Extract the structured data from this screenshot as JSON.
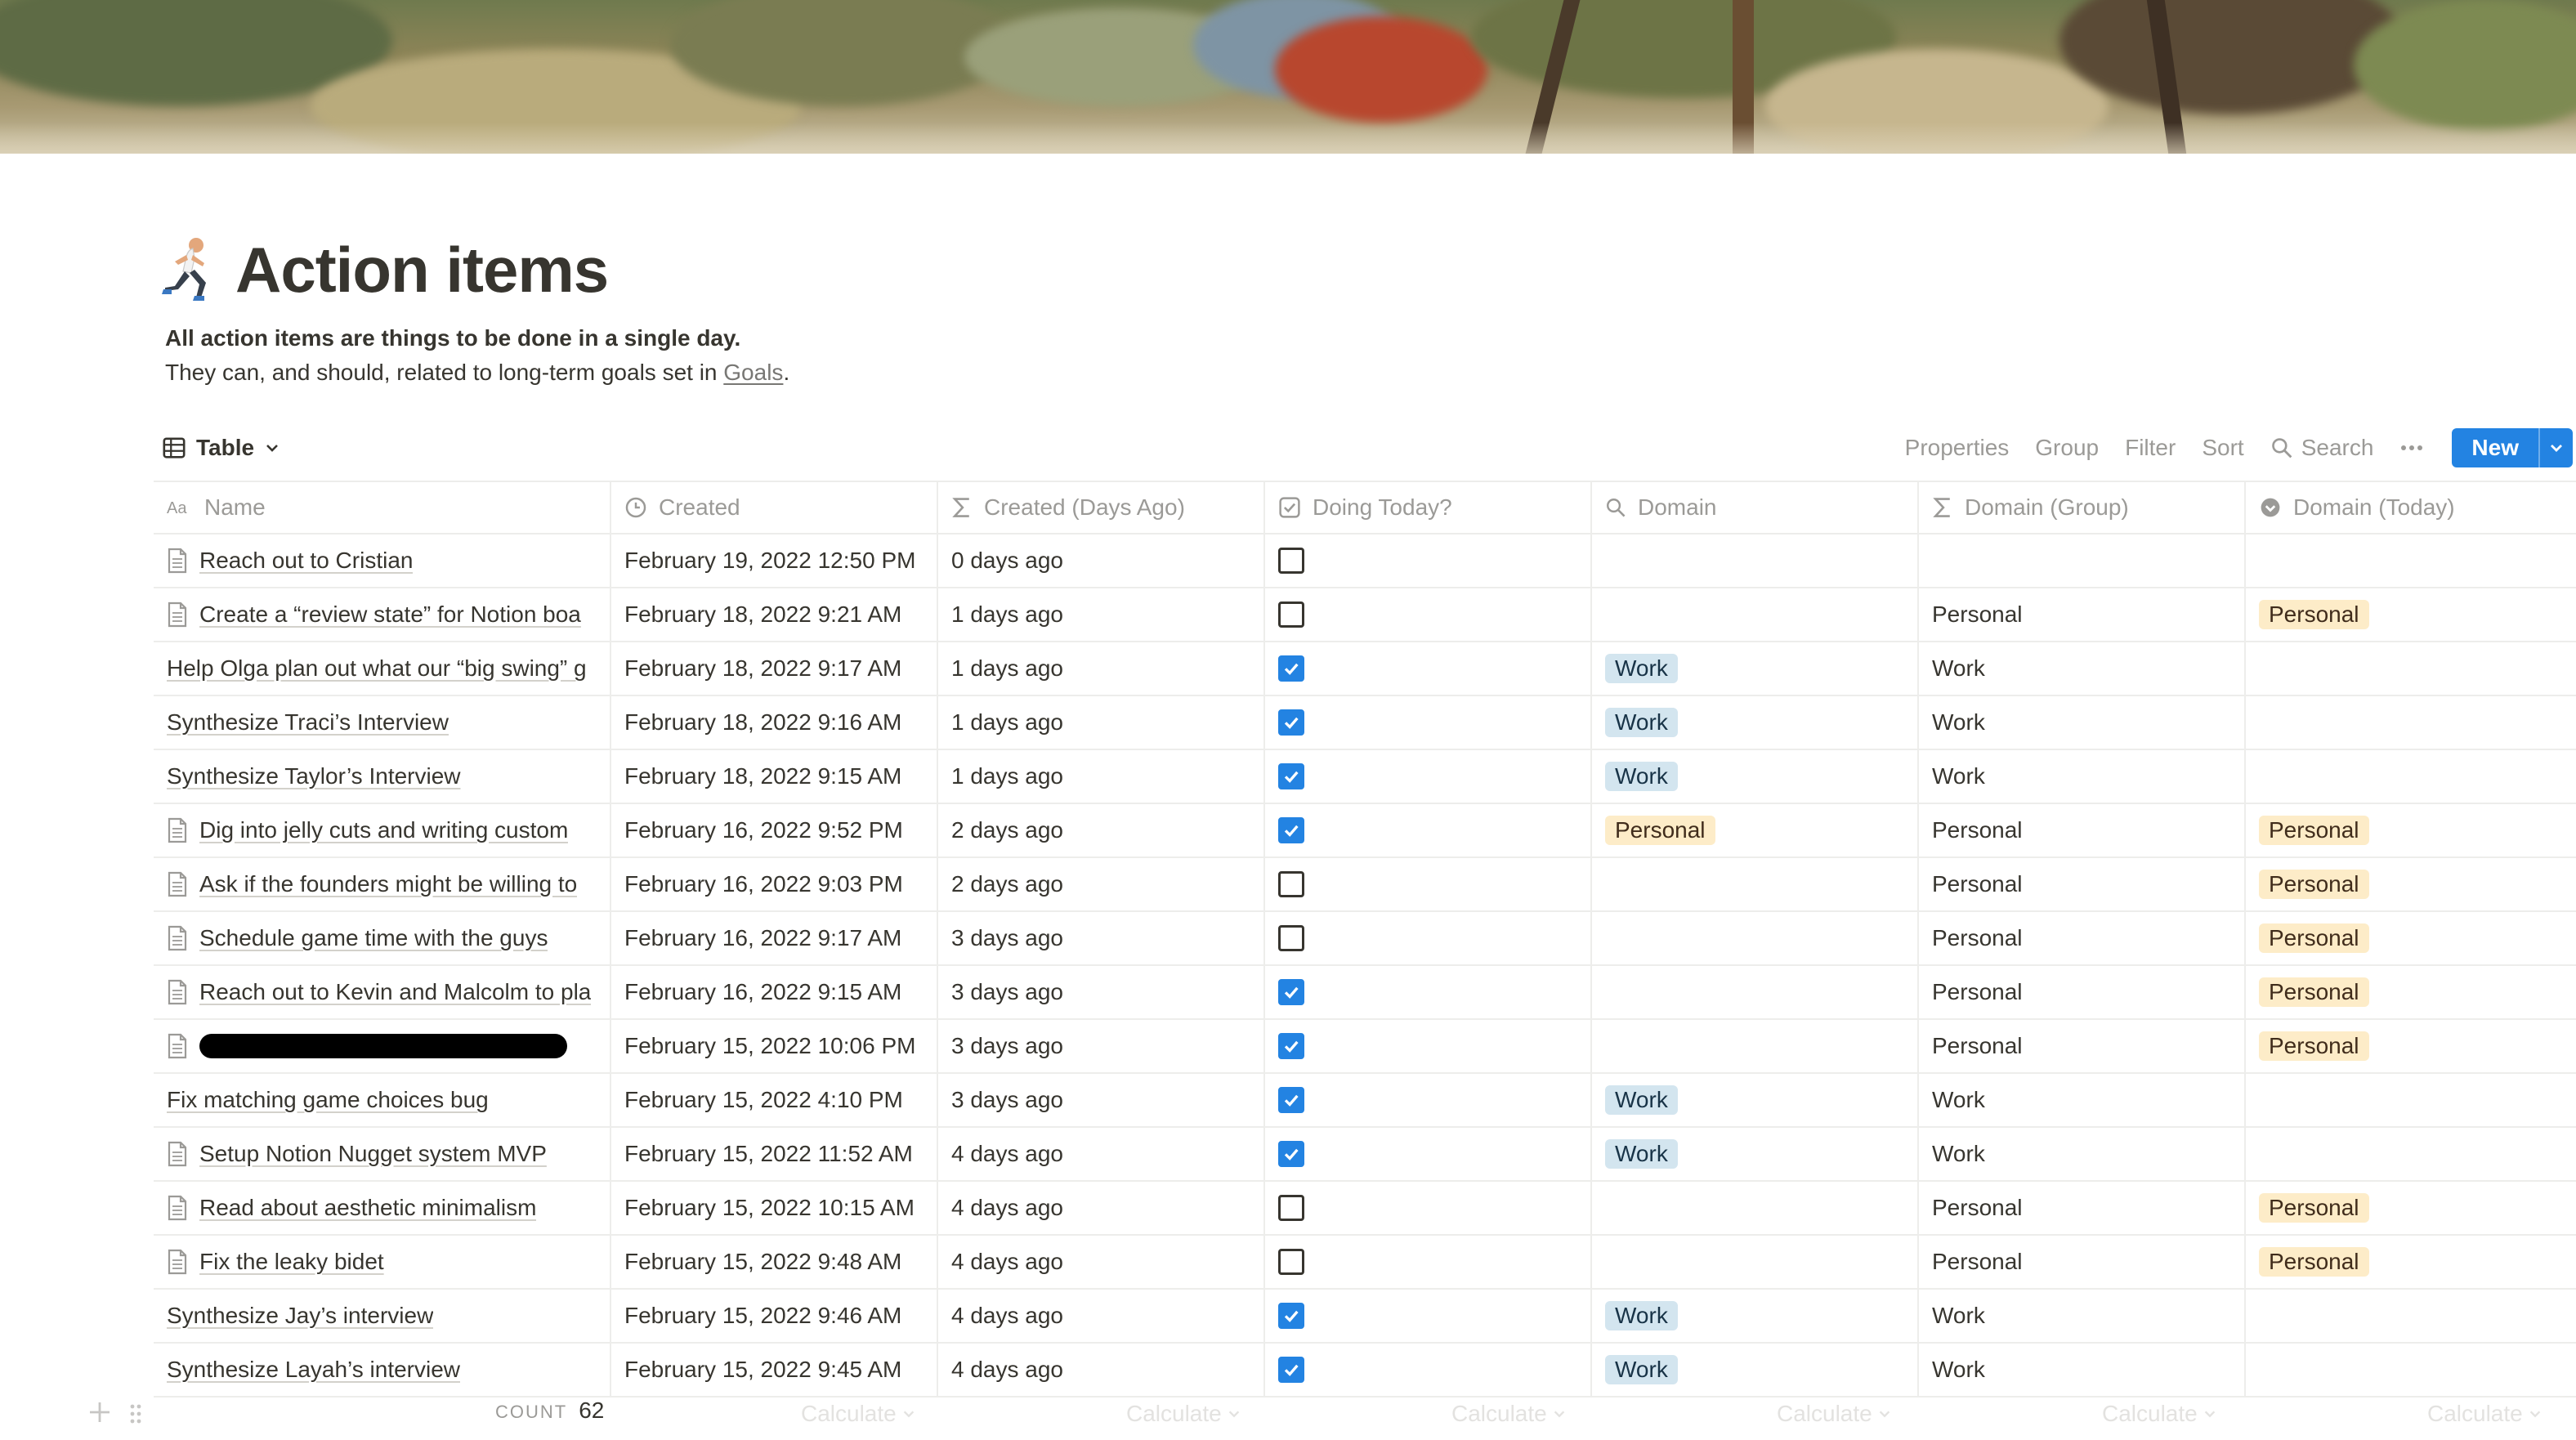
{
  "page": {
    "emoji": "runner-emoji",
    "title": "Action items",
    "description_line1": "All action items are things to be done in a single day.",
    "description_line2_prefix": "They can, and should, related to long-term goals set in ",
    "description_link": "Goals",
    "description_line2_suffix": "."
  },
  "view": {
    "tab_label": "Table",
    "properties": "Properties",
    "group": "Group",
    "filter": "Filter",
    "sort": "Sort",
    "search": "Search",
    "new_label": "New"
  },
  "columns": [
    {
      "label": "Name",
      "icon": "text-aa-icon"
    },
    {
      "label": "Created",
      "icon": "clock-icon"
    },
    {
      "label": "Created (Days Ago)",
      "icon": "sigma-icon"
    },
    {
      "label": "Doing Today?",
      "icon": "checkbox-icon"
    },
    {
      "label": "Domain",
      "icon": "search-relation-icon"
    },
    {
      "label": "Domain (Group)",
      "icon": "sigma-icon"
    },
    {
      "label": "Domain (Today)",
      "icon": "rollup-icon"
    }
  ],
  "rows": [
    {
      "name": "Reach out to Cristian",
      "doc": true,
      "created": "February 19, 2022 12:50 PM",
      "days": "0 days ago",
      "today": false,
      "domain": "",
      "group": "",
      "dtoday": ""
    },
    {
      "name": "Create a “review state” for Notion boa",
      "doc": true,
      "created": "February 18, 2022 9:21 AM",
      "days": "1 days ago",
      "today": false,
      "domain": "",
      "group": "Personal",
      "dtoday": "Personal"
    },
    {
      "name": "Help Olga plan out what our “big swing” g",
      "doc": false,
      "created": "February 18, 2022 9:17 AM",
      "days": "1 days ago",
      "today": true,
      "domain": "Work",
      "group": "Work",
      "dtoday": ""
    },
    {
      "name": "Synthesize Traci’s Interview",
      "doc": false,
      "created": "February 18, 2022 9:16 AM",
      "days": "1 days ago",
      "today": true,
      "domain": "Work",
      "group": "Work",
      "dtoday": ""
    },
    {
      "name": "Synthesize Taylor’s Interview",
      "doc": false,
      "created": "February 18, 2022 9:15 AM",
      "days": "1 days ago",
      "today": true,
      "domain": "Work",
      "group": "Work",
      "dtoday": ""
    },
    {
      "name": "Dig into jelly cuts and writing custom",
      "doc": true,
      "created": "February 16, 2022 9:52 PM",
      "days": "2 days ago",
      "today": true,
      "domain": "Personal",
      "group": "Personal",
      "dtoday": "Personal"
    },
    {
      "name": "Ask if the founders might be willing to",
      "doc": true,
      "created": "February 16, 2022 9:03 PM",
      "days": "2 days ago",
      "today": false,
      "domain": "",
      "group": "Personal",
      "dtoday": "Personal"
    },
    {
      "name": "Schedule game time with the guys",
      "doc": true,
      "created": "February 16, 2022 9:17 AM",
      "days": "3 days ago",
      "today": false,
      "domain": "",
      "group": "Personal",
      "dtoday": "Personal"
    },
    {
      "name": "Reach out to Kevin and Malcolm to pla",
      "doc": true,
      "created": "February 16, 2022 9:15 AM",
      "days": "3 days ago",
      "today": true,
      "domain": "",
      "group": "Personal",
      "dtoday": "Personal"
    },
    {
      "name": "",
      "doc": true,
      "redacted": true,
      "created": "February 15, 2022 10:06 PM",
      "days": "3 days ago",
      "today": true,
      "domain": "",
      "group": "Personal",
      "dtoday": "Personal"
    },
    {
      "name": "Fix matching game choices bug",
      "doc": false,
      "created": "February 15, 2022 4:10 PM",
      "days": "3 days ago",
      "today": true,
      "domain": "Work",
      "group": "Work",
      "dtoday": ""
    },
    {
      "name": "Setup Notion Nugget system MVP",
      "doc": true,
      "created": "February 15, 2022 11:52 AM",
      "days": "4 days ago",
      "today": true,
      "domain": "Work",
      "group": "Work",
      "dtoday": ""
    },
    {
      "name": "Read about aesthetic minimalism",
      "doc": true,
      "created": "February 15, 2022 10:15 AM",
      "days": "4 days ago",
      "today": false,
      "domain": "",
      "group": "Personal",
      "dtoday": "Personal"
    },
    {
      "name": "Fix the leaky bidet",
      "doc": true,
      "created": "February 15, 2022 9:48 AM",
      "days": "4 days ago",
      "today": false,
      "domain": "",
      "group": "Personal",
      "dtoday": "Personal"
    },
    {
      "name": "Synthesize Jay’s interview",
      "doc": false,
      "created": "February 15, 2022 9:46 AM",
      "days": "4 days ago",
      "today": true,
      "domain": "Work",
      "group": "Work",
      "dtoday": ""
    },
    {
      "name": "Synthesize Layah’s interview",
      "doc": false,
      "created": "February 15, 2022 9:45 AM",
      "days": "4 days ago",
      "today": true,
      "domain": "Work",
      "group": "Work",
      "dtoday": ""
    }
  ],
  "footer": {
    "count_label": "COUNT",
    "count_value": "62",
    "calculate_label": "Calculate"
  },
  "colors": {
    "accent": "#2383e2",
    "work_tag_bg": "#d3e5ef",
    "personal_tag_bg": "#fdecc8"
  }
}
